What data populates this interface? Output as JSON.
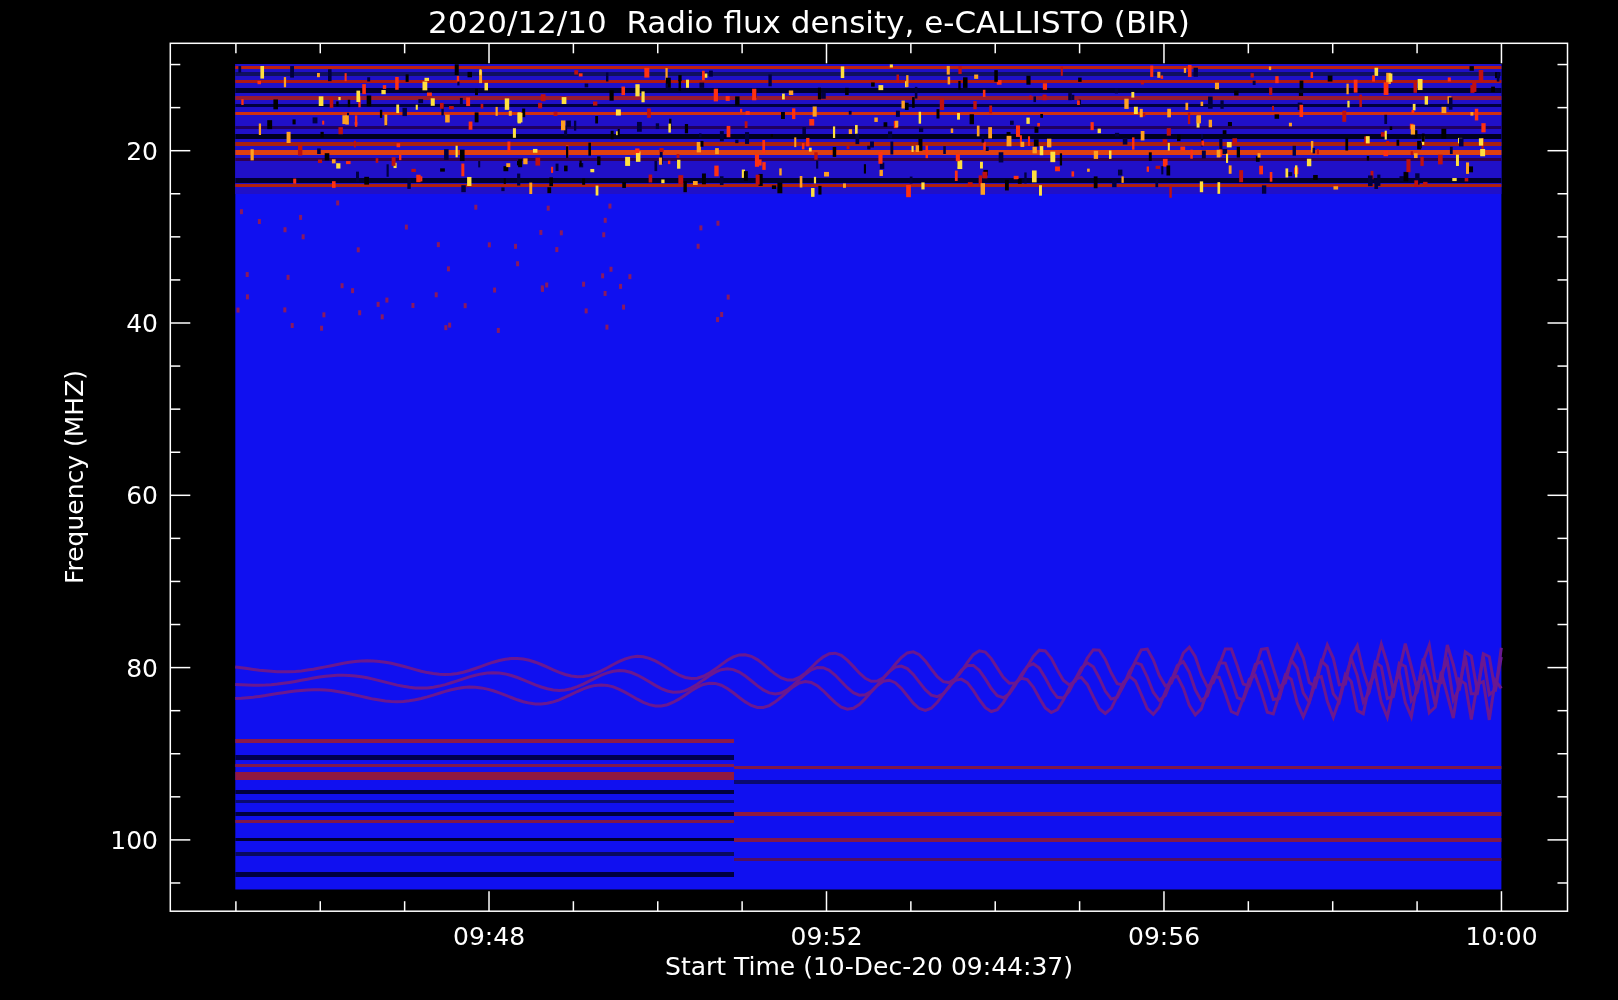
{
  "plot": {
    "title": "2020/12/10  Radio flux density, e-CALLISTO (BIR)",
    "y_axis": {
      "label": "Frequency (MHZ)",
      "tick_labels": [
        "20",
        "40",
        "60",
        "80",
        "100"
      ]
    },
    "x_axis": {
      "label": "Start Time (10-Dec-20 09:44:37)",
      "tick_labels": [
        "09:48",
        "09:52",
        "09:56",
        "10:00"
      ]
    }
  }
}
